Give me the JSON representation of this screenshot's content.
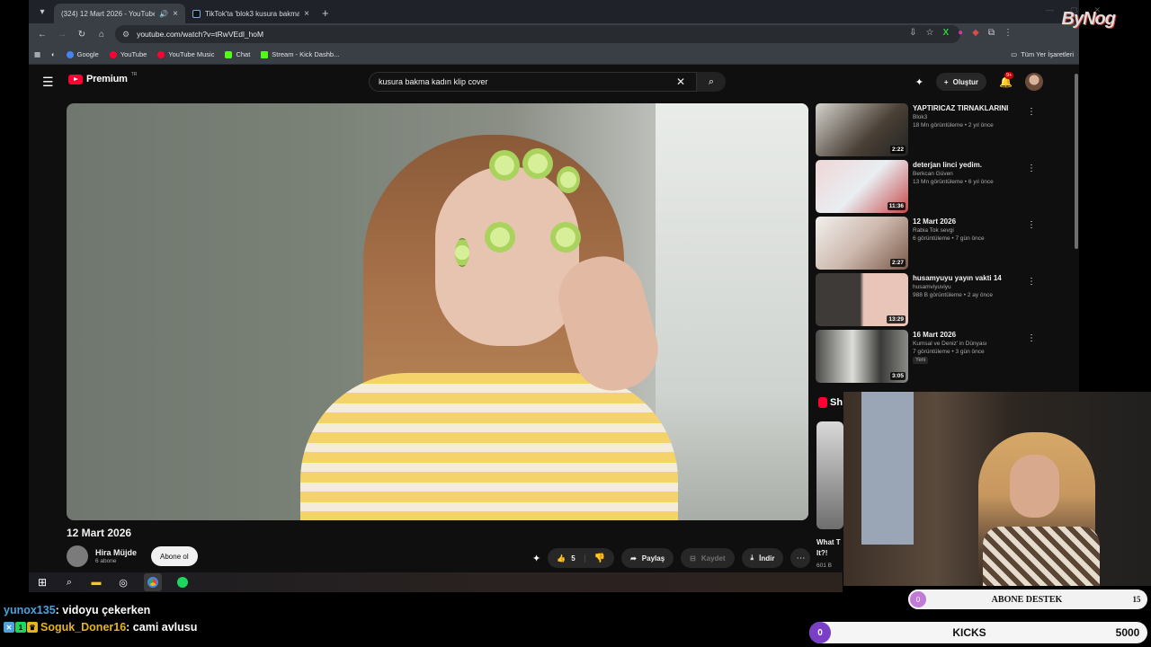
{
  "browser": {
    "tabs": [
      {
        "title": "(324) 12 Mart 2026 - YouTube",
        "active": true
      },
      {
        "title": "TikTok'ta 'blok3 kusura bakma'",
        "active": false
      }
    ],
    "url": "youtube.com/watch?v=tRwVEdl_hoM",
    "bookmarks": [
      "Google",
      "YouTube",
      "YouTube Music",
      "Chat",
      "Stream - Kick Dashb..."
    ],
    "bookmarks_right": "Tüm Yer İşaretleri"
  },
  "youtube": {
    "logo": "Premium",
    "logo_sup": "TR",
    "search_query": "kusura bakma kadın klip cover",
    "create_label": "Oluştur",
    "notif_count": "9+",
    "video": {
      "title": "12 Mart 2026",
      "channel": "Hira Müjde",
      "subscribers": "6 abone",
      "subscribe_label": "Abone ol",
      "likes": "5",
      "share_label": "Paylaş",
      "save_label": "Kaydet",
      "download_label": "İndir"
    },
    "recommendations": [
      {
        "title": "YAPTIRICAZ TIRNAKLARINI",
        "channel": "Blok3",
        "meta": "18 Mn görüntüleme • 2 yıl önce",
        "duration": "2:22",
        "tag": ""
      },
      {
        "title": "deterjan linci yedim.",
        "channel": "Berkcan Güven",
        "meta": "13 Mn görüntüleme • 6 yıl önce",
        "duration": "11:36",
        "tag": ""
      },
      {
        "title": "12 Mart 2026",
        "channel": "Rabia Tok sevgi",
        "meta": "6 görüntüleme • 7 gün önce",
        "duration": "2:27",
        "tag": ""
      },
      {
        "title": "husamyuyu yayın vakti 14",
        "channel": "husamviyuviyu",
        "meta": "988 B görüntüleme • 2 ay önce",
        "duration": "13:29",
        "tag": ""
      },
      {
        "title": "16 Mart 2026",
        "channel": "Kumsal ve Deniz' in Dünyası",
        "meta": "7 görüntüleme • 3 gün önce",
        "duration": "3:05",
        "tag": "Yeni"
      }
    ],
    "shorts_peek": "Sh",
    "short_title": "What T\nIt?!",
    "short_views": "601 B"
  },
  "stream": {
    "branding": "ByNog",
    "goal_sub": {
      "current": "0",
      "label": "ABONE DESTEK",
      "target": "15"
    },
    "goal_kicks": {
      "current": "0",
      "label": "KICKS",
      "target": "5000"
    },
    "chat": [
      {
        "user": "yunox135",
        "text": " : vidoyu çekerken",
        "color": "blue",
        "badges": false
      },
      {
        "user": "Soguk_Doner16",
        "text": " : cami avlusu",
        "color": "gold",
        "badges": true
      }
    ]
  },
  "colors": {
    "youtube_red": "#ff0033",
    "kick_green": "#53fc18",
    "goal_purple": "#7a3fc7"
  }
}
